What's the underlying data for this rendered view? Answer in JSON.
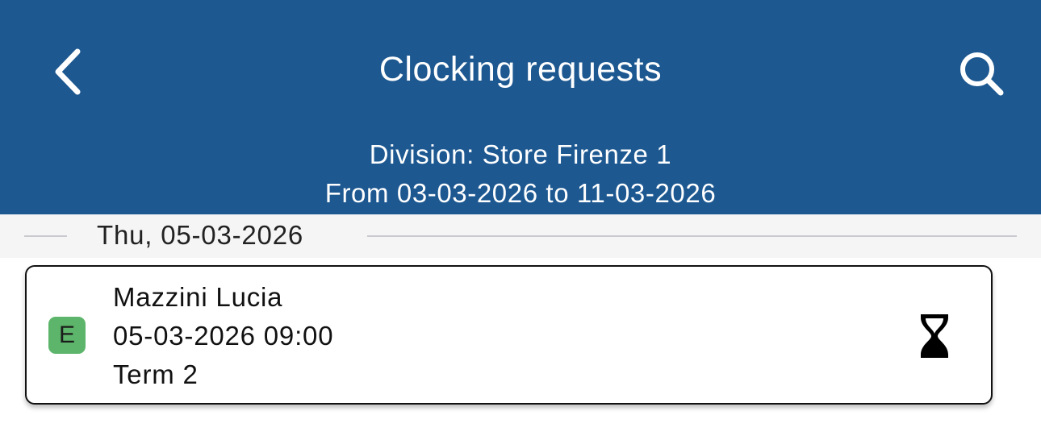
{
  "header": {
    "title": "Clocking requests",
    "division": "Division: Store Firenze 1",
    "range": "From 03-03-2026 to 11-03-2026",
    "back_icon": "chevron-left-icon",
    "search_icon": "search-icon"
  },
  "groups": [
    {
      "date": "Thu, 05-03-2026",
      "items": [
        {
          "badge": "E",
          "badge_color": "#5cb56a",
          "name": "Mazzini Lucia",
          "datetime": "05-03-2026 09:00",
          "terminal": "Term 2",
          "status_icon": "hourglass-icon"
        }
      ]
    }
  ],
  "colors": {
    "header_bg": "#1d5891",
    "band_bg": "#f5f5f5"
  }
}
